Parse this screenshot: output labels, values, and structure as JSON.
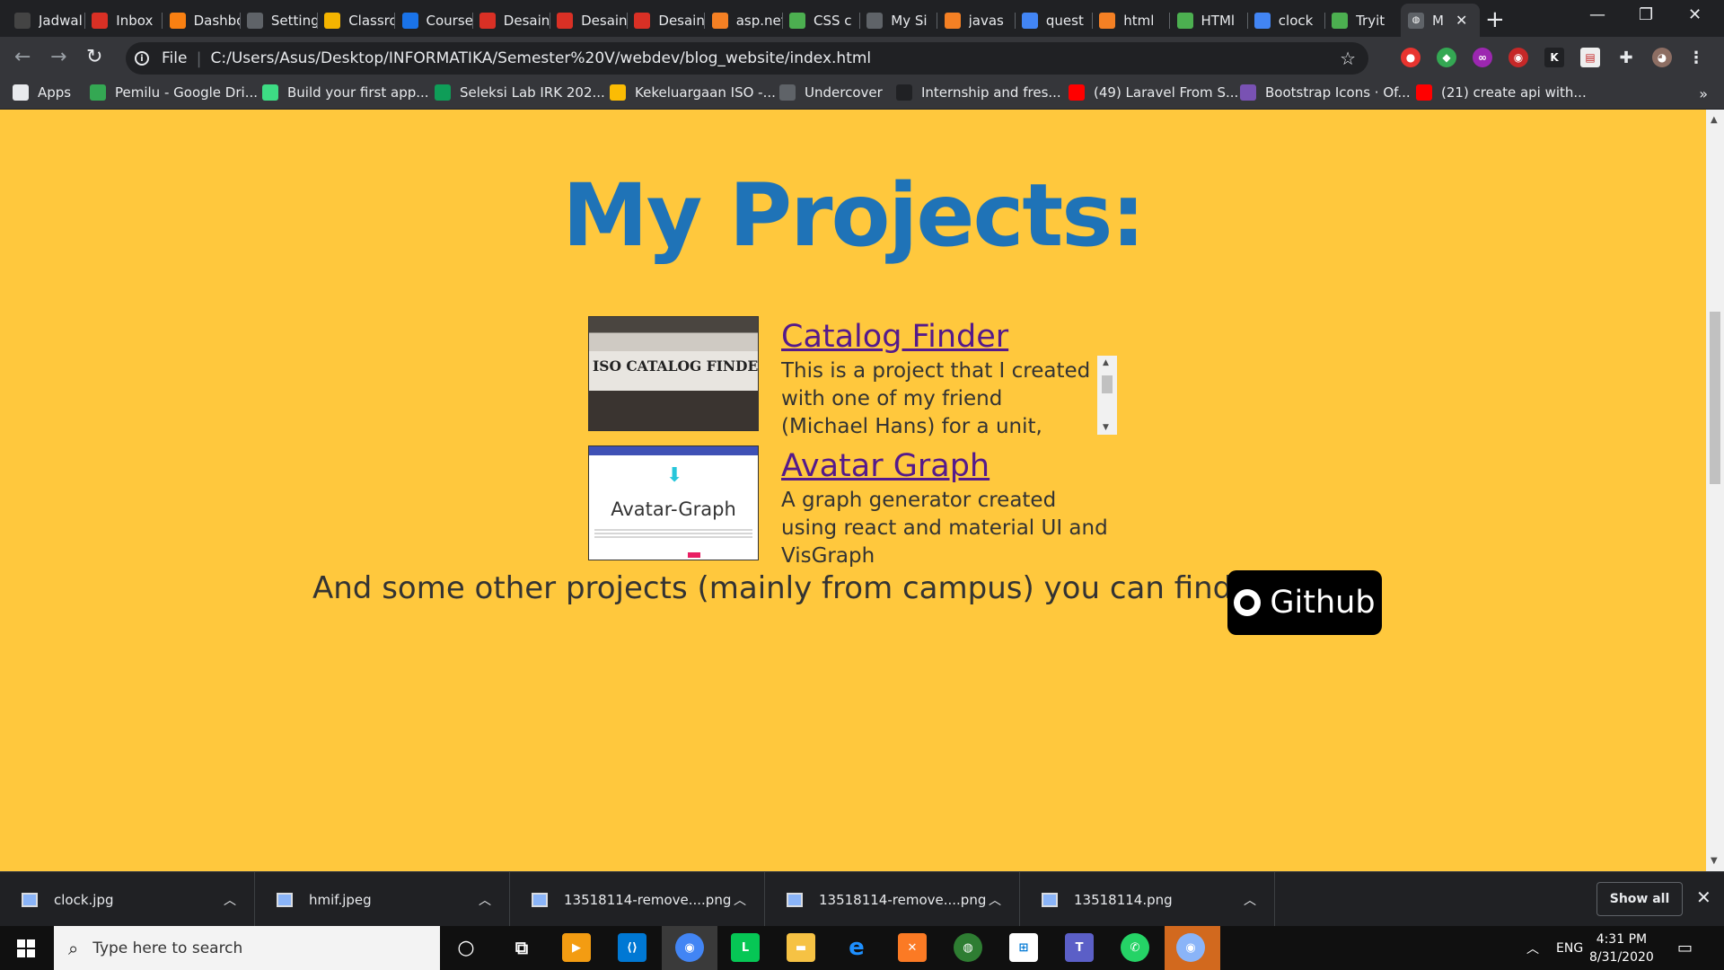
{
  "tabs": [
    {
      "label": "Jadwal",
      "icon": "pdf-icon",
      "color": "#444"
    },
    {
      "label": "Inbox",
      "icon": "gmail-icon",
      "color": "#d93025"
    },
    {
      "label": "Dashboard",
      "icon": "moodle-icon",
      "color": "#f98012"
    },
    {
      "label": "Settings",
      "icon": "gear-icon",
      "color": "#5f6368"
    },
    {
      "label": "Classroom",
      "icon": "classroom-icon",
      "color": "#f4b400"
    },
    {
      "label": "Courses",
      "icon": "globe-icon",
      "color": "#1a73e8"
    },
    {
      "label": "Desain",
      "icon": "calendar-icon",
      "color": "#d93025"
    },
    {
      "label": "Desain",
      "icon": "calendar-icon",
      "color": "#d93025"
    },
    {
      "label": "Desain",
      "icon": "calendar-icon",
      "color": "#d93025"
    },
    {
      "label": "asp.net",
      "icon": "stackoverflow-icon",
      "color": "#f48024"
    },
    {
      "label": "CSS c",
      "icon": "w3schools-icon",
      "color": "#4caf50"
    },
    {
      "label": "My Si",
      "icon": "globe-icon",
      "color": "#5f6368"
    },
    {
      "label": "javas",
      "icon": "stackoverflow-icon",
      "color": "#f48024"
    },
    {
      "label": "quest",
      "icon": "google-icon",
      "color": "#4285f4"
    },
    {
      "label": "html",
      "icon": "stackoverflow-icon",
      "color": "#f48024"
    },
    {
      "label": "HTMl",
      "icon": "w3schools-icon",
      "color": "#4caf50"
    },
    {
      "label": "clock",
      "icon": "google-icon",
      "color": "#4285f4"
    },
    {
      "label": "Tryit",
      "icon": "w3schools-icon",
      "color": "#4caf50"
    }
  ],
  "active_tab": {
    "label": "M",
    "icon": "globe-icon"
  },
  "toolbar": {
    "scheme": "File",
    "url": "C:/Users/Asus/Desktop/INFORMATIKA/Semester%20V/webdev/blog_website/index.html"
  },
  "bookmarks": [
    {
      "label": "Apps",
      "icon": "apps-grid-icon",
      "color": "#e8eaed"
    },
    {
      "label": "Pemilu - Google Dri...",
      "icon": "google-drive-icon",
      "color": "#34a853"
    },
    {
      "label": "Build your first app...",
      "icon": "android-icon",
      "color": "#3ddc84"
    },
    {
      "label": "Seleksi Lab IRK 202...",
      "icon": "google-sheets-icon",
      "color": "#0f9d58"
    },
    {
      "label": "Kekeluargaan ISO -...",
      "icon": "google-drive-icon",
      "color": "#fbbc04"
    },
    {
      "label": "Undercover",
      "icon": "globe-icon",
      "color": "#5f6368"
    },
    {
      "label": "Internship and fres...",
      "icon": "circle-icon",
      "color": "#202124"
    },
    {
      "label": "(49) Laravel From S...",
      "icon": "youtube-icon",
      "color": "#ff0000"
    },
    {
      "label": "Bootstrap Icons · Of...",
      "icon": "bootstrap-icon",
      "color": "#7952b3"
    },
    {
      "label": "(21) create api with...",
      "icon": "youtube-icon",
      "color": "#ff0000"
    }
  ],
  "page": {
    "heading": "My Projects:",
    "projects": [
      {
        "title": "Catalog Finder",
        "description": "This is a project that I created with one of my friend (Michael Hans) for a unit, called ITB",
        "thumb_caption": "ISO CATALOG FINDER"
      },
      {
        "title": "Avatar Graph",
        "description": "A graph generator created using react and material UI and VisGraph",
        "thumb_caption": "Avatar-Graph"
      }
    ],
    "other_text": "And some other projects (mainly from campus) you can find on :",
    "github_label": "Github"
  },
  "downloads": {
    "items": [
      {
        "name": "clock.jpg"
      },
      {
        "name": "hmif.jpeg"
      },
      {
        "name": "13518114-remove....png"
      },
      {
        "name": "13518114-remove....png"
      },
      {
        "name": "13518114.png"
      }
    ],
    "show_all": "Show all"
  },
  "taskbar": {
    "search_placeholder": "Type here to search",
    "language": "ENG",
    "time": "4:31 PM",
    "date": "8/31/2020"
  }
}
